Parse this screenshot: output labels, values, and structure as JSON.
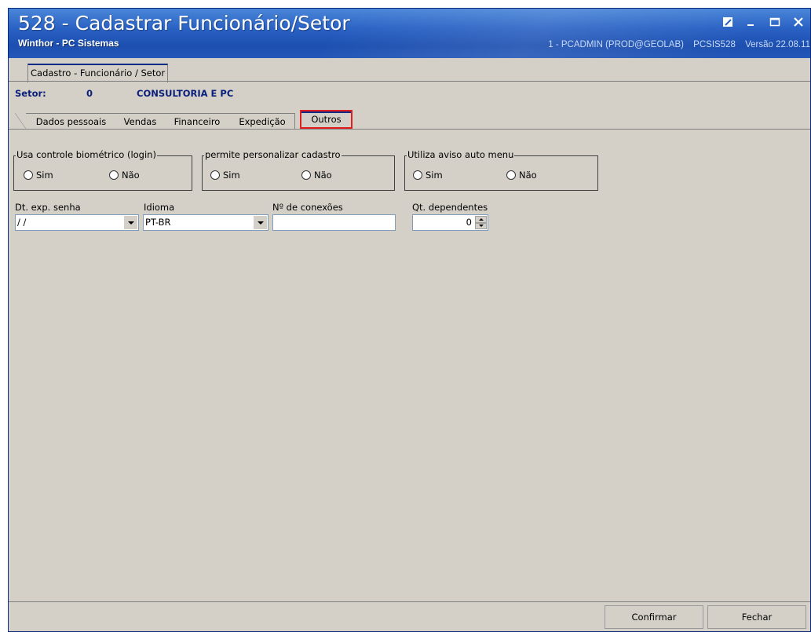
{
  "window": {
    "title": "528 - Cadastrar Funcionário/Setor",
    "subtitle": "Winthor - PC Sistemas",
    "user_info": [
      "1 - PCADMIN (PROD@GEOLAB)",
      "PCSIS528",
      "Versão 22.08.11"
    ],
    "controls": [
      "restore-icon",
      "minimize-icon",
      "maximize-icon",
      "close-icon"
    ]
  },
  "main_tab": {
    "label": "Cadastro - Funcionário / Setor"
  },
  "setor": {
    "label": "Setor:",
    "code": "0",
    "name": "CONSULTORIA E PC"
  },
  "tabs": [
    {
      "label": "Dados pessoais",
      "active": false
    },
    {
      "label": "Vendas",
      "active": false
    },
    {
      "label": "Financeiro",
      "active": false
    },
    {
      "label": "Expedição",
      "active": false
    },
    {
      "label": "Outros",
      "active": true
    }
  ],
  "groups": [
    {
      "legend": "Usa controle biométrico (login)",
      "options": [
        "Sim",
        "Não"
      ]
    },
    {
      "legend": "permite personalizar cadastro",
      "options": [
        "Sim",
        "Não"
      ]
    },
    {
      "legend": "Utiliza aviso auto menu",
      "options": [
        "Sim",
        "Não"
      ]
    }
  ],
  "fields": {
    "dt_exp_senha": {
      "label": "Dt. exp. senha",
      "value": "/ /"
    },
    "idioma": {
      "label": "Idioma",
      "value": "PT-BR"
    },
    "num_conexoes": {
      "label": "Nº de conexões",
      "value": ""
    },
    "qt_dependentes": {
      "label": "Qt. dependentes",
      "value": "0"
    }
  },
  "buttons": {
    "confirm": "Confirmar",
    "close": "Fechar"
  },
  "colors": {
    "title_bar": "#2a62c4",
    "window_bg": "#d4d0c8",
    "setor_text": "#0a1f7a",
    "highlight": "#e21d1d"
  }
}
